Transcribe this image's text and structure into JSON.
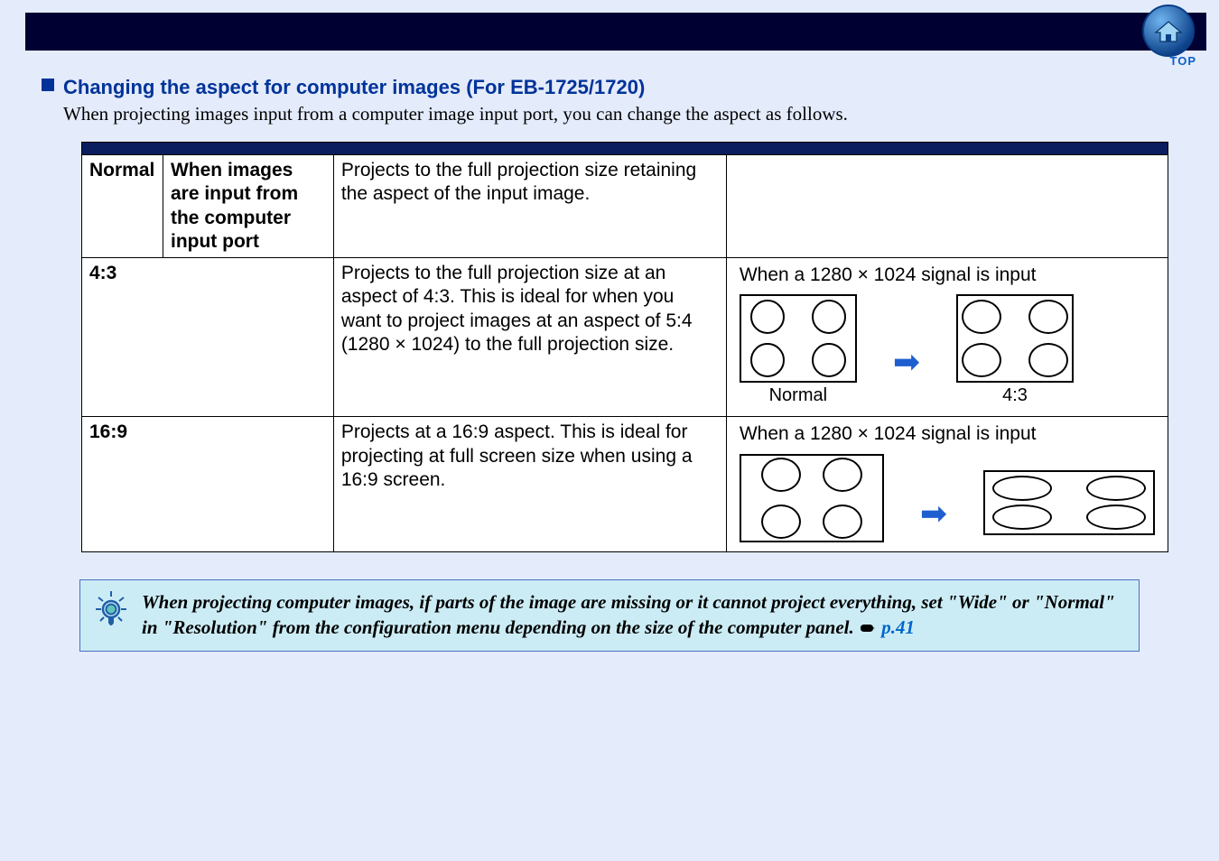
{
  "header": {
    "top_link_label": "TOP"
  },
  "section": {
    "heading": "Changing the aspect for computer images  (For EB-1725/1720)",
    "intro": "When projecting images input from a computer image input port, you can change the aspect as follows."
  },
  "table": {
    "row1": {
      "name": "Normal",
      "condition": "When images are input from the computer input port",
      "description": "Projects to the full projection size retaining the aspect of the input image."
    },
    "row2": {
      "name": "4:3",
      "description": "Projects to the full projection size at an aspect of 4:3. This is ideal for when you want to project images at an aspect of 5:4 (1280 × 1024) to the full projection size.",
      "vis_caption": "When a 1280 × 1024 signal is input",
      "label_left": "Normal",
      "label_right": "4:3"
    },
    "row3": {
      "name": "16:9",
      "description": "Projects at a 16:9 aspect. This is ideal for projecting at full screen size when using a 16:9 screen.",
      "vis_caption": "When a 1280 × 1024 signal is input"
    }
  },
  "note": {
    "text_a": "When projecting computer images, if parts of the image are missing or it cannot project everything, set \"Wide\" or \"Normal\" in \"Resolution\" from the configuration menu depending on the size of the computer panel.  ",
    "link": "p.41"
  }
}
